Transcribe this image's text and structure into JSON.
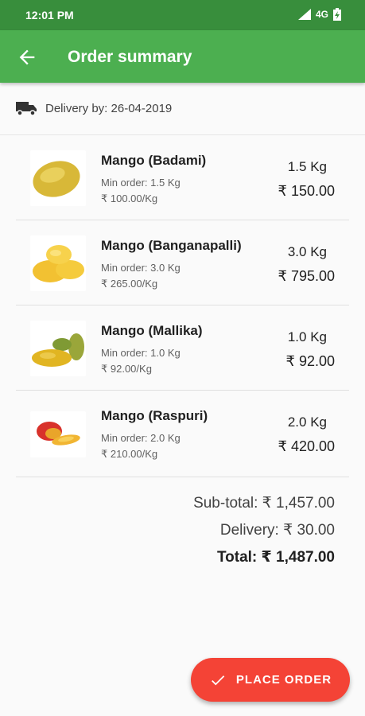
{
  "status_bar": {
    "time": "12:01 PM",
    "network": "4G"
  },
  "header": {
    "title": "Order summary"
  },
  "delivery": {
    "text": "Delivery by: 26-04-2019"
  },
  "items": [
    {
      "name": "Mango (Badami)",
      "min_order": "Min order: 1.5 Kg",
      "rate": "₹ 100.00/Kg",
      "qty": "1.5 Kg",
      "price": "₹ 150.00"
    },
    {
      "name": "Mango (Banganapalli)",
      "min_order": "Min order: 3.0 Kg",
      "rate": "₹ 265.00/Kg",
      "qty": "3.0 Kg",
      "price": "₹ 795.00"
    },
    {
      "name": "Mango (Mallika)",
      "min_order": "Min order: 1.0 Kg",
      "rate": "₹ 92.00/Kg",
      "qty": "1.0 Kg",
      "price": "₹ 92.00"
    },
    {
      "name": "Mango (Raspuri)",
      "min_order": "Min order: 2.0 Kg",
      "rate": "₹ 210.00/Kg",
      "qty": "2.0 Kg",
      "price": "₹ 420.00"
    }
  ],
  "totals": {
    "subtotal": "Sub-total: ₹ 1,457.00",
    "delivery": "Delivery: ₹ 30.00",
    "total": "Total: ₹ 1,487.00"
  },
  "fab": {
    "label": "PLACE ORDER"
  },
  "colors": {
    "status_bar": "#388e3c",
    "app_bar": "#4caf50",
    "fab": "#f44336"
  }
}
